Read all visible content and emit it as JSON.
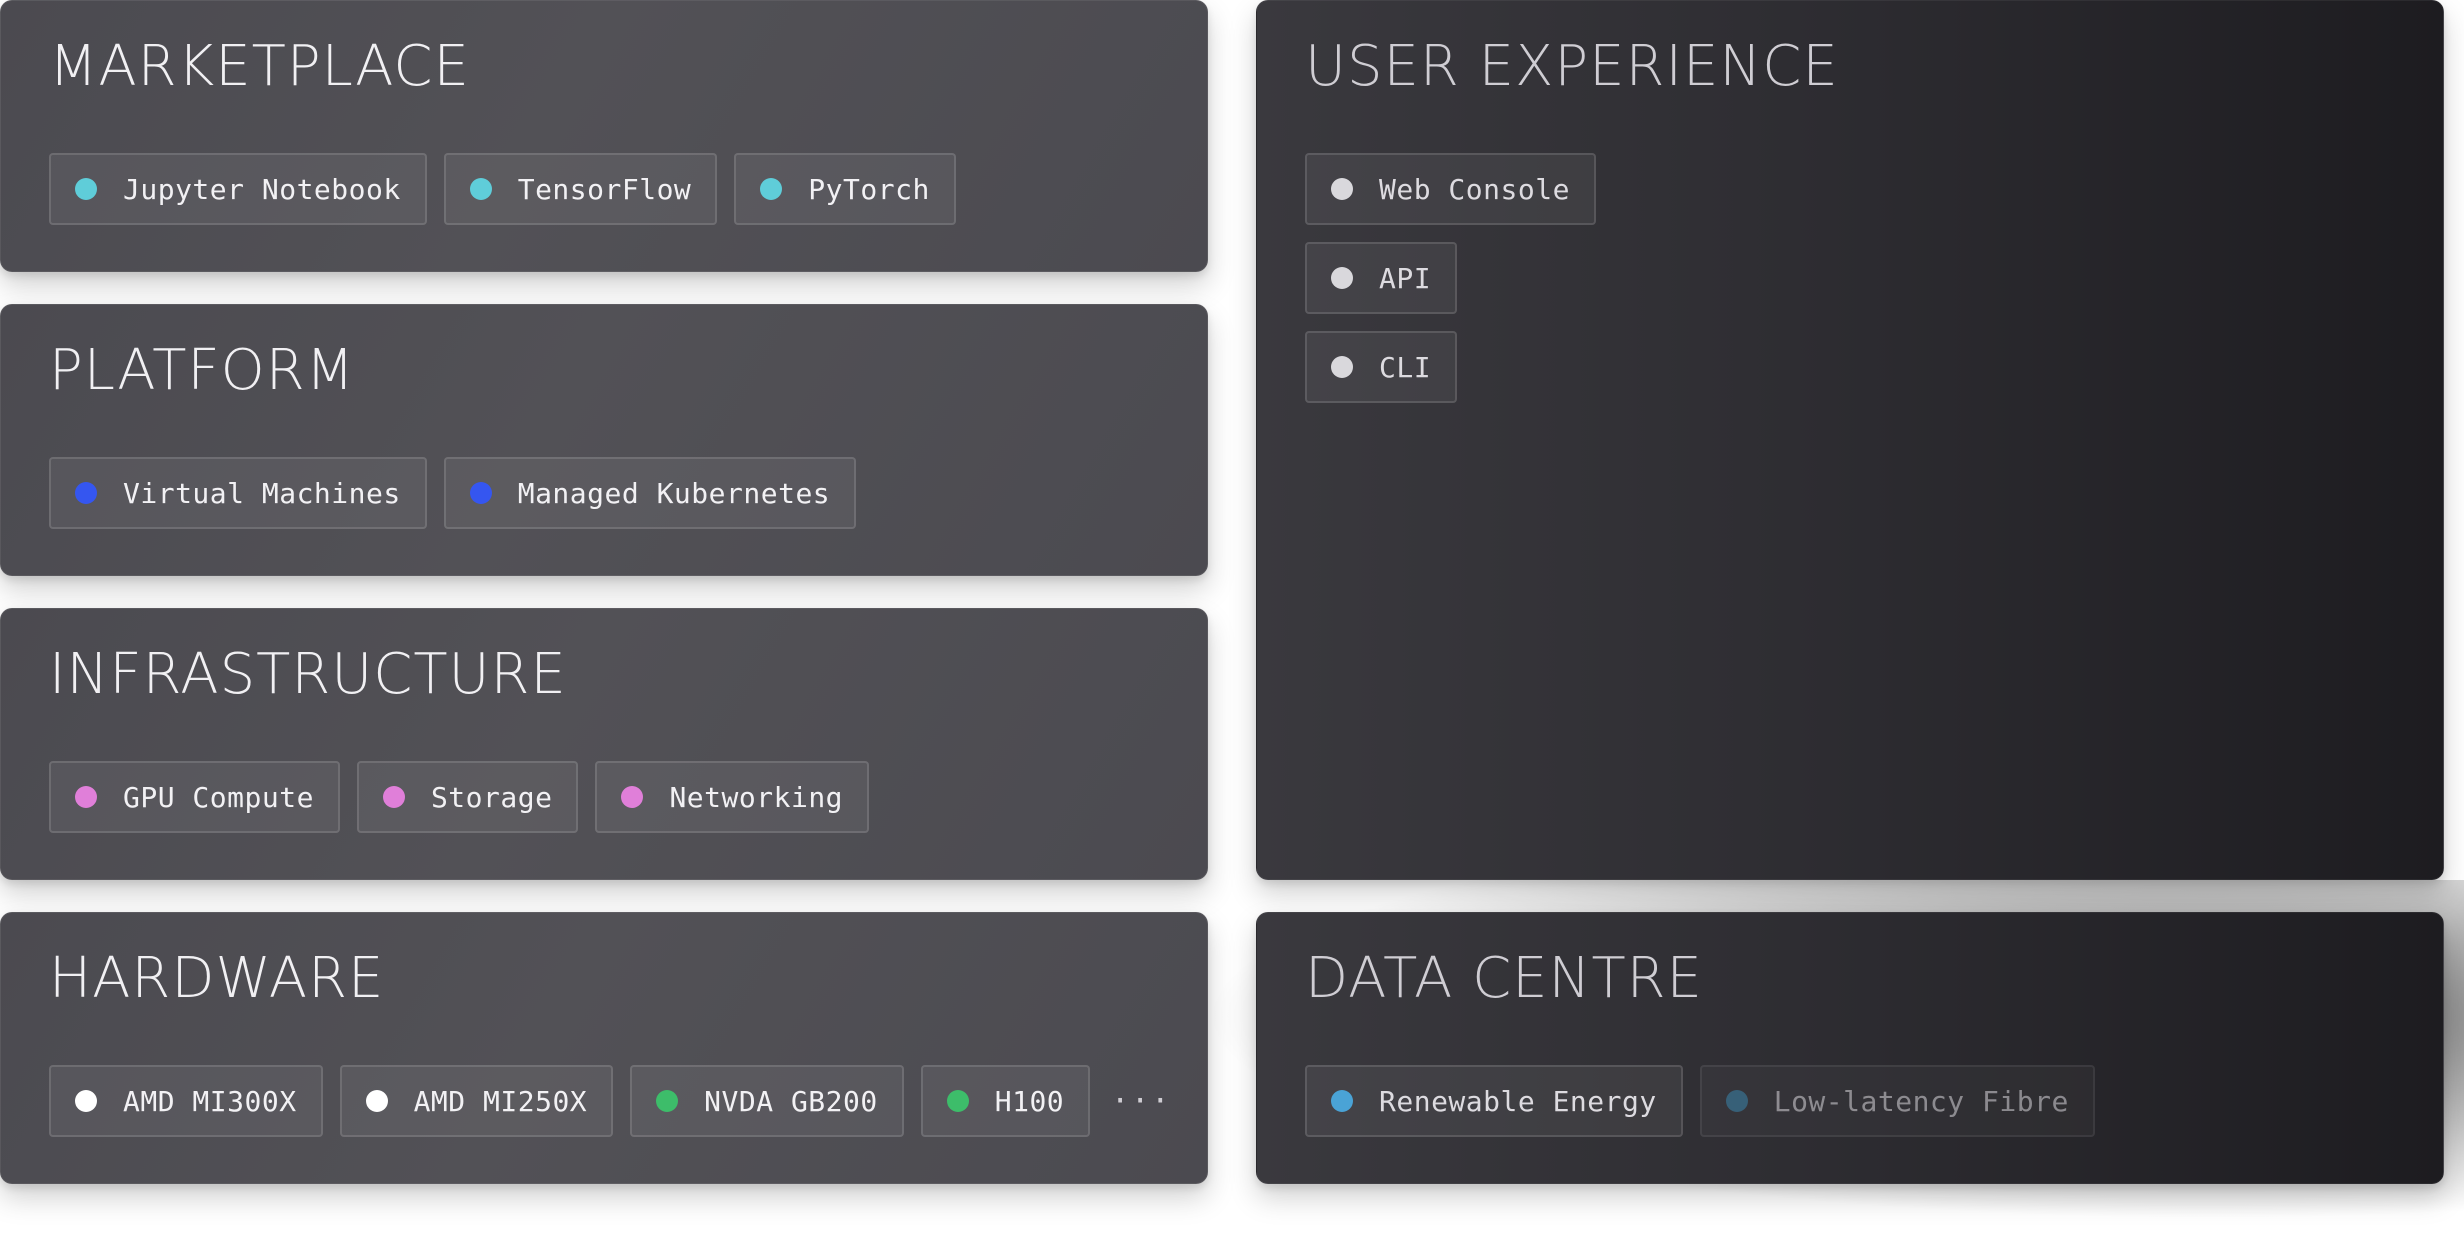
{
  "panels": {
    "marketplace": {
      "title": "MARKETPLACE",
      "items": [
        {
          "label": "Jupyter Notebook",
          "color": "#5fcdd9"
        },
        {
          "label": "TensorFlow",
          "color": "#5fcdd9"
        },
        {
          "label": "PyTorch",
          "color": "#5fcdd9"
        }
      ]
    },
    "platform": {
      "title": "PLATFORM",
      "items": [
        {
          "label": "Virtual Machines",
          "color": "#3556f0"
        },
        {
          "label": "Managed Kubernetes",
          "color": "#3556f0"
        }
      ]
    },
    "infrastructure": {
      "title": "INFRASTRUCTURE",
      "items": [
        {
          "label": "GPU Compute",
          "color": "#e07fd9"
        },
        {
          "label": "Storage",
          "color": "#e07fd9"
        },
        {
          "label": "Networking",
          "color": "#e07fd9"
        }
      ]
    },
    "hardware": {
      "title": "HARDWARE",
      "items": [
        {
          "label": "AMD MI300X",
          "color": "#ffffff"
        },
        {
          "label": "AMD MI250X",
          "color": "#ffffff"
        },
        {
          "label": "NVDA GB200",
          "color": "#3dbd6a"
        },
        {
          "label": "H100",
          "color": "#3dbd6a"
        }
      ],
      "more_label": "···"
    },
    "user_experience": {
      "title": "USER EXPERIENCE",
      "items": [
        {
          "label": "Web Console",
          "color": "#d9d8dc"
        },
        {
          "label": "API",
          "color": "#d9d8dc"
        },
        {
          "label": "CLI",
          "color": "#d9d8dc"
        }
      ]
    },
    "data_centre": {
      "title": "DATA CENTRE",
      "items": [
        {
          "label": "Renewable Energy",
          "color": "#4aa3d6"
        },
        {
          "label": "Low-latency Fibre",
          "color": "#3f89b2"
        }
      ]
    }
  }
}
